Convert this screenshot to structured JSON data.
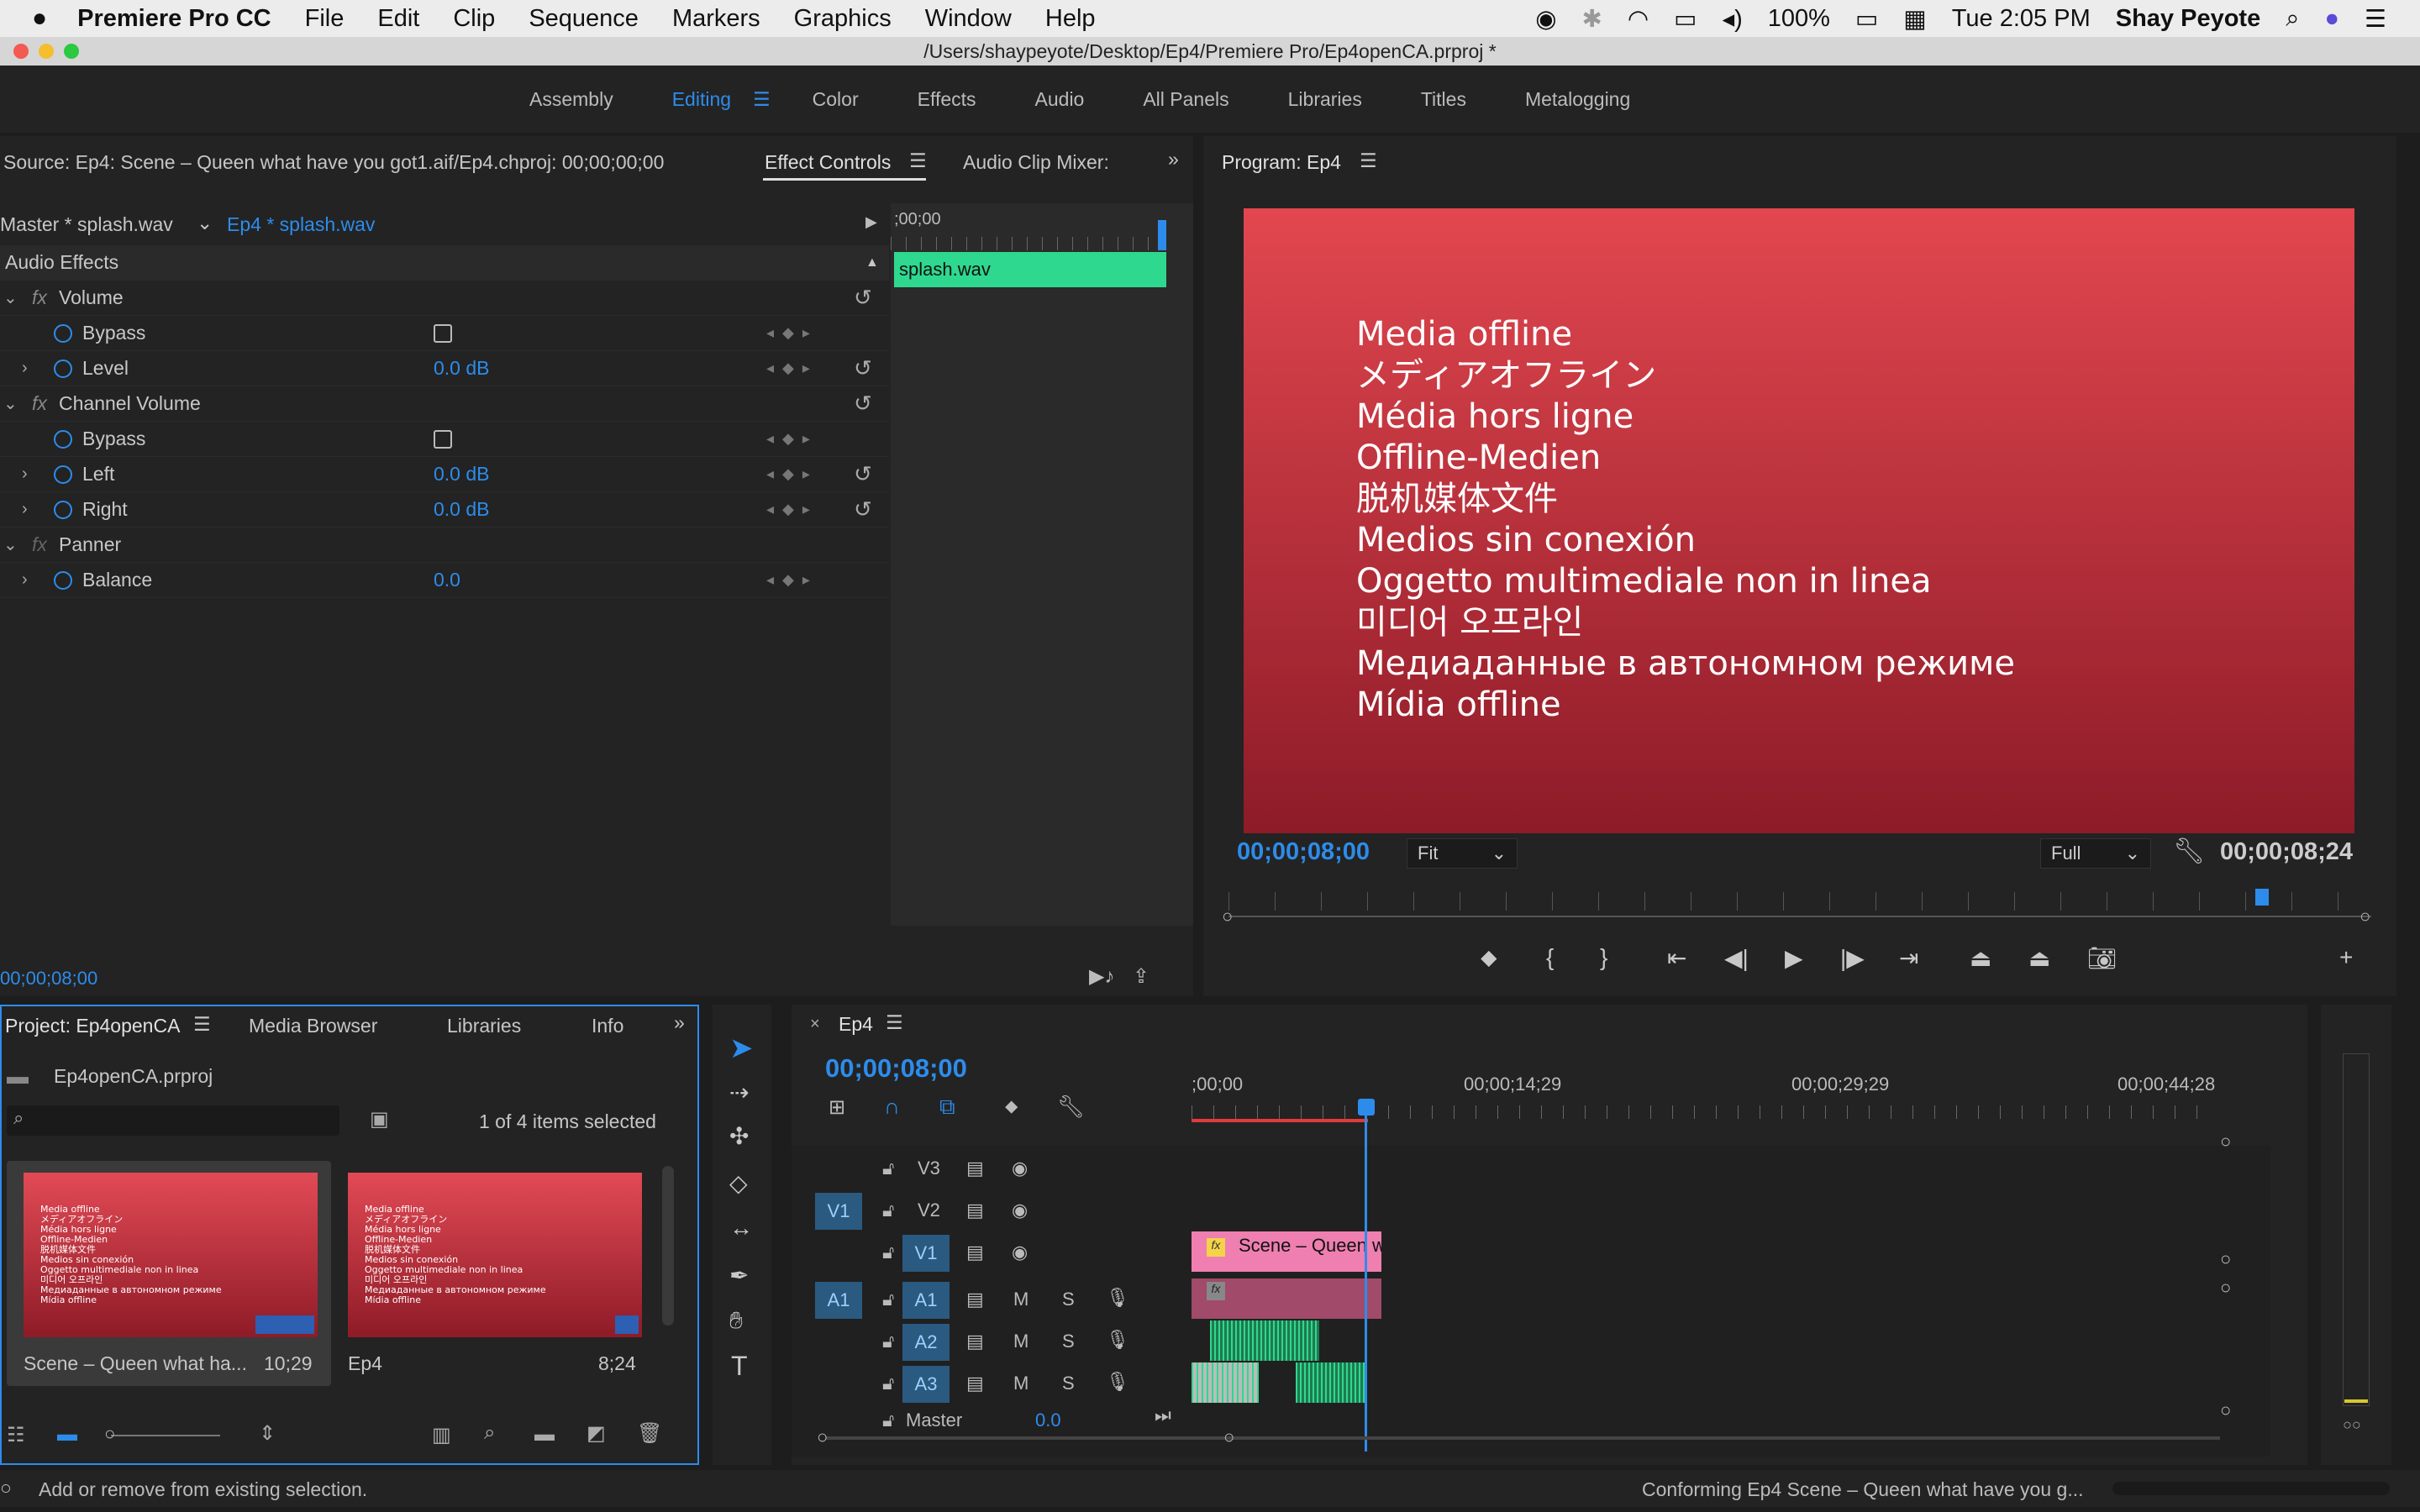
{
  "menubar": {
    "app_name": "Premiere Pro CC",
    "items": [
      "File",
      "Edit",
      "Clip",
      "Sequence",
      "Markers",
      "Graphics",
      "Window",
      "Help"
    ],
    "battery": "100%",
    "clock": "Tue 2:05 PM",
    "user": "Shay Peyote"
  },
  "window": {
    "title": "/Users/shaypeyote/Desktop/Ep4/Premiere Pro/Ep4openCA.prproj *"
  },
  "workspaces": [
    "Assembly",
    "Editing",
    "Color",
    "Effects",
    "Audio",
    "All Panels",
    "Libraries",
    "Titles",
    "Metalogging"
  ],
  "source_panel": {
    "source_tab": "Source: Ep4: Scene – Queen what have you got1.aif/Ep4.chproj: 00;00;00;00",
    "effect_controls_tab": "Effect Controls",
    "audio_mixer_tab": "Audio Clip Mixer:",
    "master_clip": "Master * splash.wav",
    "seq_clip": "Ep4 * splash.wav",
    "ruler_time": ";00;00",
    "clip_name": "splash.wav",
    "section_label": "Audio Effects",
    "rows": [
      {
        "label": "Volume"
      },
      {
        "label": "Bypass"
      },
      {
        "label": "Level",
        "value": "0.0 dB"
      },
      {
        "label": "Channel Volume"
      },
      {
        "label": "Bypass"
      },
      {
        "label": "Left",
        "value": "0.0 dB"
      },
      {
        "label": "Right",
        "value": "0.0 dB"
      },
      {
        "label": "Panner"
      },
      {
        "label": "Balance",
        "value": "0.0"
      }
    ],
    "timecode": "00;00;08;00"
  },
  "program": {
    "title": "Program: Ep4",
    "offline_lines": [
      "Media offline",
      "メディアオフライン",
      "Média hors ligne",
      "Offline-Medien",
      "脱机媒体文件",
      "Medios sin conexión",
      "Oggetto multimediale non in linea",
      "미디어 오프라인",
      "Медиаданные в автономном режиме",
      "Mídia offline"
    ],
    "current_time": "00;00;08;00",
    "fit": "Fit",
    "quality": "Full",
    "duration": "00;00;08;24"
  },
  "project": {
    "tabs": [
      "Project: Ep4openCA",
      "Media Browser",
      "Libraries",
      "Info"
    ],
    "file": "Ep4openCA.prproj",
    "selection": "1 of 4 items selected",
    "items": [
      {
        "name": "Scene – Queen what ha...",
        "duration": "10;29"
      },
      {
        "name": "Ep4",
        "duration": "8;24"
      }
    ]
  },
  "timeline": {
    "tab": "Ep4",
    "timecode": "00;00;08;00",
    "ruler": [
      ";00;00",
      "00;00;14;29",
      "00;00;29;29",
      "00;00;44;28"
    ],
    "video_tracks": [
      "V3",
      "V2",
      "V1"
    ],
    "audio_tracks": [
      "A1",
      "A2",
      "A3"
    ],
    "master_label": "Master",
    "master_value": "0.0",
    "clip_label": "Scene – Queen w",
    "src_v1": "V1",
    "src_a1": "A1",
    "mute": "M",
    "solo": "S"
  },
  "statusbar": {
    "left": "Add or remove from existing selection.",
    "right": "Conforming Ep4 Scene – Queen what have you g..."
  },
  "colors": {
    "accent": "#2d8ceb",
    "panel": "#232323",
    "clip_green": "#2fd88f",
    "clip_pink": "#ef7fb0",
    "offline_red": "#d73f4a"
  }
}
